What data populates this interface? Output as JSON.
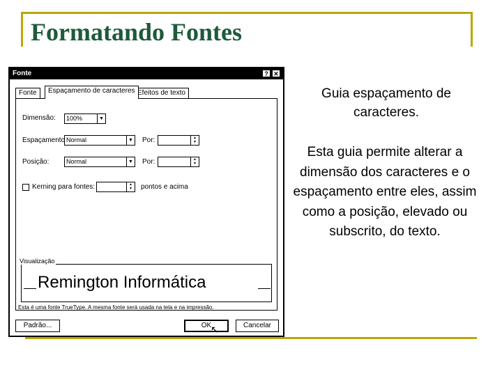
{
  "slide": {
    "title": "Formatando Fontes",
    "heading": "Guia espaçamento de caracteres.",
    "body": "Esta guia permite alterar a dimensão dos caracteres e o espaçamento entre eles, assim como a posição, elevado ou subscrito, do texto."
  },
  "dialog": {
    "title": "Fonte",
    "help_label": "?",
    "close_label": "✕",
    "tabs": [
      {
        "label": "Fonte"
      },
      {
        "label": "Espaçamento de caracteres"
      },
      {
        "label": "Efeitos de texto"
      }
    ],
    "fields": {
      "dimension_label": "Dimensão:",
      "dimension_value": "100%",
      "spacing_label": "Espaçamento:",
      "spacing_value": "Normal",
      "spacing_by_label": "Por:",
      "position_label": "Posição:",
      "position_value": "Normal",
      "position_by_label": "Por:",
      "kerning_label": "Kerning para fontes:",
      "kerning_suffix": "pontos e acima"
    },
    "preview": {
      "label": "Visualização",
      "text": "Remington Informática",
      "info": "Esta é uma fonte TrueType. A mesma fonte será usada na tela e na impressão."
    },
    "buttons": {
      "default_label": "Padrão...",
      "ok_label": "OK",
      "cancel_label": "Cancelar"
    }
  }
}
